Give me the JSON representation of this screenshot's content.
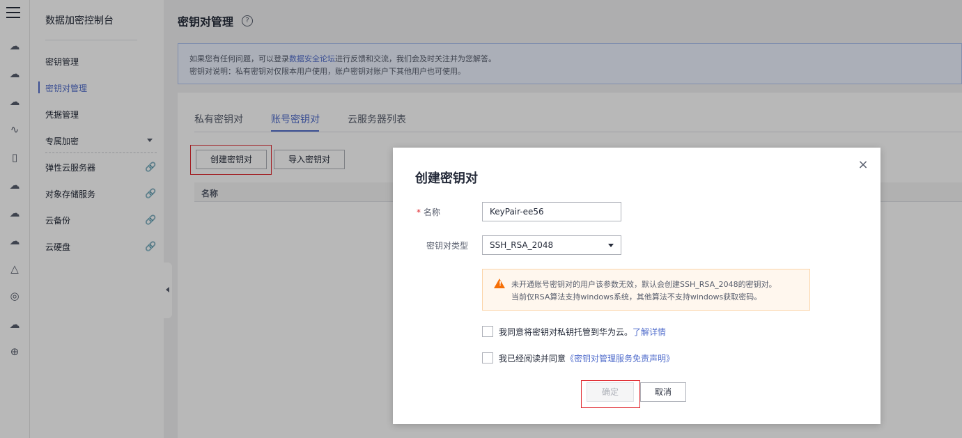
{
  "sidebar": {
    "title": "数据加密控制台",
    "items": [
      {
        "label": "密钥管理"
      },
      {
        "label": "密钥对管理"
      },
      {
        "label": "凭据管理"
      },
      {
        "label": "专属加密"
      },
      {
        "label": "弹性云服务器"
      },
      {
        "label": "对象存储服务"
      },
      {
        "label": "云备份"
      },
      {
        "label": "云硬盘"
      }
    ]
  },
  "rail": {
    "icons": [
      "cloud-icon",
      "cloud-dots-icon",
      "cloud-server-icon",
      "wave-icon",
      "device-icon",
      "cloud-outline-icon",
      "cloud-up-icon",
      "cloud-link-icon",
      "sail-icon",
      "ip-icon",
      "cluster-icon",
      "globe-icon"
    ]
  },
  "header": {
    "title": "密钥对管理",
    "help_icon": "?"
  },
  "notice": {
    "line1_prefix": "如果您有任何问题，可以登录",
    "line1_link": "数据安全论坛",
    "line1_suffix": "进行反馈和交流，我们会及时关注并为您解答。",
    "line2": "密钥对说明：私有密钥对仅限本用户使用，账户密钥对账户下其他用户也可使用。"
  },
  "tabs": [
    {
      "label": "私有密钥对"
    },
    {
      "label": "账号密钥对"
    },
    {
      "label": "云服务器列表"
    }
  ],
  "toolbar": {
    "create_label": "创建密钥对",
    "import_label": "导入密钥对"
  },
  "table": {
    "col_name": "名称"
  },
  "dialog": {
    "title": "创建密钥对",
    "close": "×",
    "name_required_mark": "*",
    "name_label": "名称",
    "name_value": "KeyPair-ee56",
    "type_label": "密钥对类型",
    "type_value": "SSH_RSA_2048",
    "warning_icon": "!",
    "warning_line1": "未开通账号密钥对的用户该参数无效，默认会创建SSH_RSA_2048的密钥对。",
    "warning_line2": "当前仅RSA算法支持windows系统，其他算法不支持windows获取密码。",
    "check1_label": "我同意将密钥对私钥托管到华为云。",
    "check1_link": "了解详情",
    "check2_label": "我已经阅读并同意",
    "check2_link": "《密钥对管理服务免责声明》",
    "ok_label": "确定",
    "cancel_label": "取消"
  },
  "colors": {
    "accent": "#526ecc",
    "highlight": "#e0252b",
    "warning": "#f66f06"
  }
}
